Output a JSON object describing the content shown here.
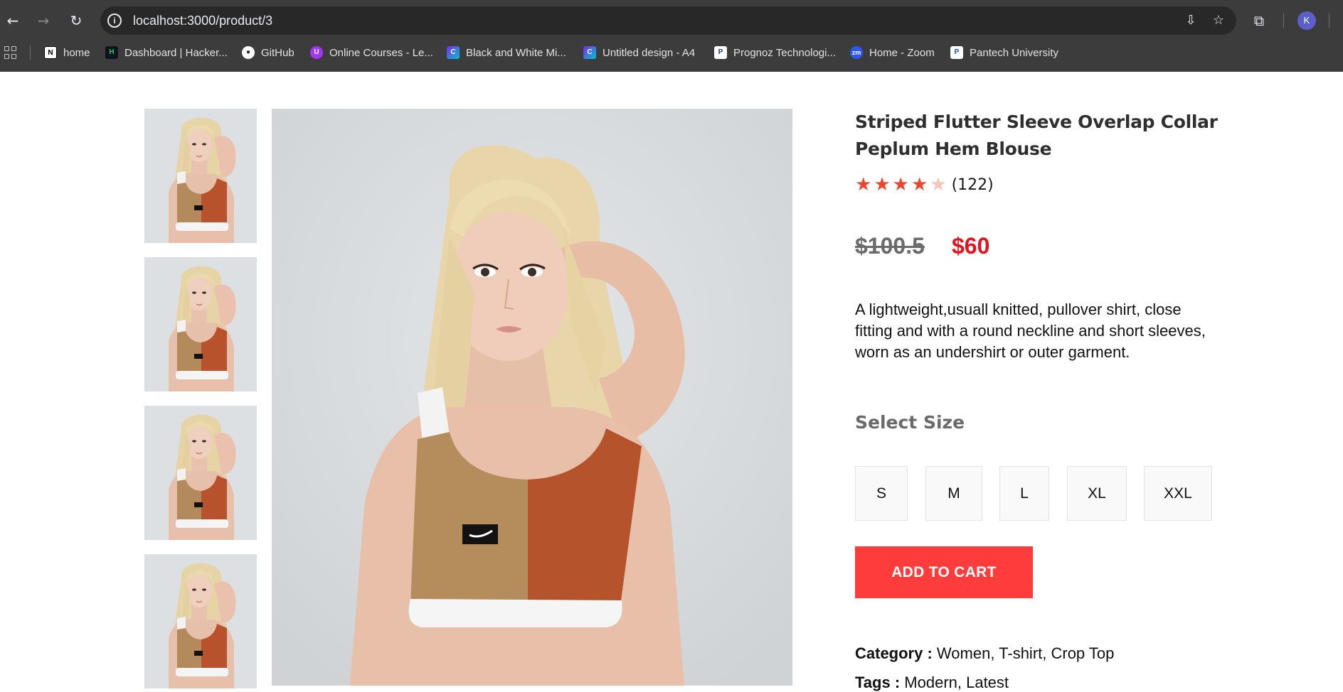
{
  "browser": {
    "url": "localhost:3000/product/3",
    "profile_initial": "K",
    "bookmarks": [
      {
        "label": "home",
        "icon": "notion-icon"
      },
      {
        "label": "Dashboard | Hacker...",
        "icon": "hackerrank-icon"
      },
      {
        "label": "GitHub",
        "icon": "github-icon"
      },
      {
        "label": "Online Courses - Le...",
        "icon": "udemy-icon"
      },
      {
        "label": "Black and White Mi...",
        "icon": "canva-icon"
      },
      {
        "label": "Untitled design - A4",
        "icon": "canva-icon"
      },
      {
        "label": "Prognoz Technologi...",
        "icon": "prognoz-icon"
      },
      {
        "label": "Home - Zoom",
        "icon": "zoom-icon"
      },
      {
        "label": "Pantech University",
        "icon": "pantech-icon"
      }
    ]
  },
  "product": {
    "title": "Striped Flutter Sleeve Overlap Collar Peplum Hem Blouse",
    "rating": 4,
    "rating_max": 5,
    "review_count": "(122)",
    "old_price": "$100.5",
    "new_price": "$60",
    "description": "A lightweight,usuall knitted, pullover shirt, close fitting and with a round neckline and short sleeves, worn as an undershirt or outer garment.",
    "size_label": "Select Size",
    "sizes": [
      "S",
      "M",
      "L",
      "XL",
      "XXL"
    ],
    "add_to_cart": "ADD TO CART",
    "category_label": "Category :",
    "category_value": "Women, T-shirt, Crop Top",
    "tags_label": "Tags :",
    "tags_value": "Modern, Latest"
  },
  "colors": {
    "accent": "#ff3c3c",
    "sale_price": "#e8101c",
    "star": "#f0452c"
  }
}
